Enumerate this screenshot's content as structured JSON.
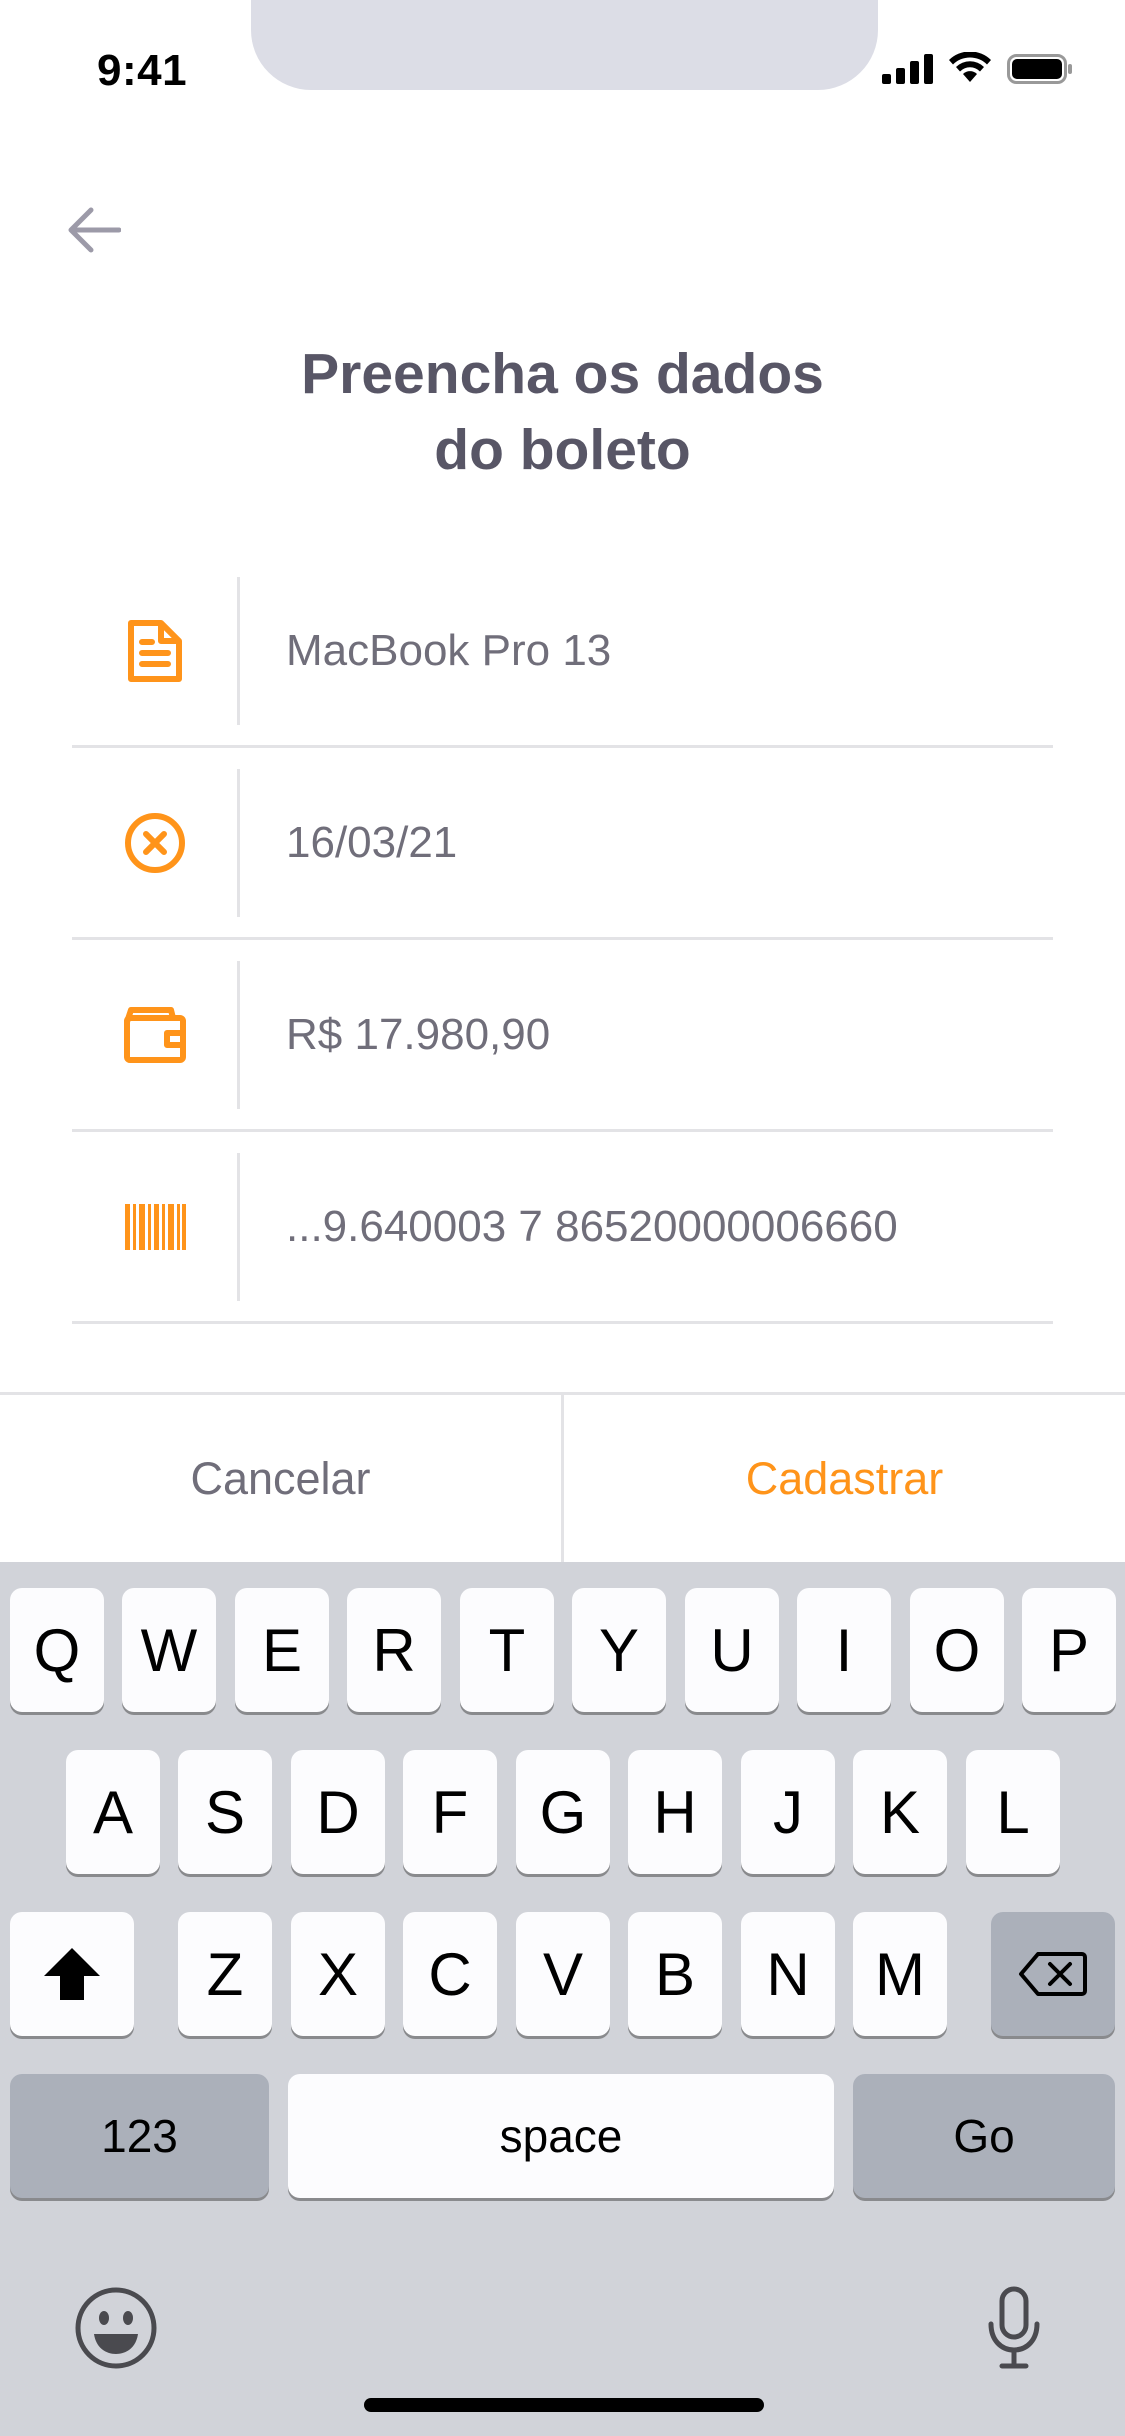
{
  "status_bar": {
    "time": "9:41"
  },
  "header": {
    "title_line1": "Preencha os dados",
    "title_line2": "do boleto"
  },
  "form": {
    "fields": [
      {
        "icon": "document-icon",
        "value": "MacBook Pro 13"
      },
      {
        "icon": "x-circle-icon",
        "value": "16/03/21"
      },
      {
        "icon": "wallet-icon",
        "value": "R$ 17.980,90"
      },
      {
        "icon": "barcode-icon",
        "value": "...9.640003 7 86520000006660"
      }
    ]
  },
  "actions": {
    "cancel": "Cancelar",
    "submit": "Cadastrar"
  },
  "keyboard": {
    "row1": [
      "Q",
      "W",
      "E",
      "R",
      "T",
      "Y",
      "U",
      "I",
      "O",
      "P"
    ],
    "row2": [
      "A",
      "S",
      "D",
      "F",
      "G",
      "H",
      "J",
      "K",
      "L"
    ],
    "row3": [
      "Z",
      "X",
      "C",
      "V",
      "B",
      "N",
      "M"
    ],
    "numbers": "123",
    "space": "space",
    "go": "Go"
  },
  "colors": {
    "accent": "#FF941A",
    "title": "#585666",
    "text": "#706E7A",
    "divider": "#E3E3E6",
    "keyboard_bg": "#D1D3D9"
  }
}
